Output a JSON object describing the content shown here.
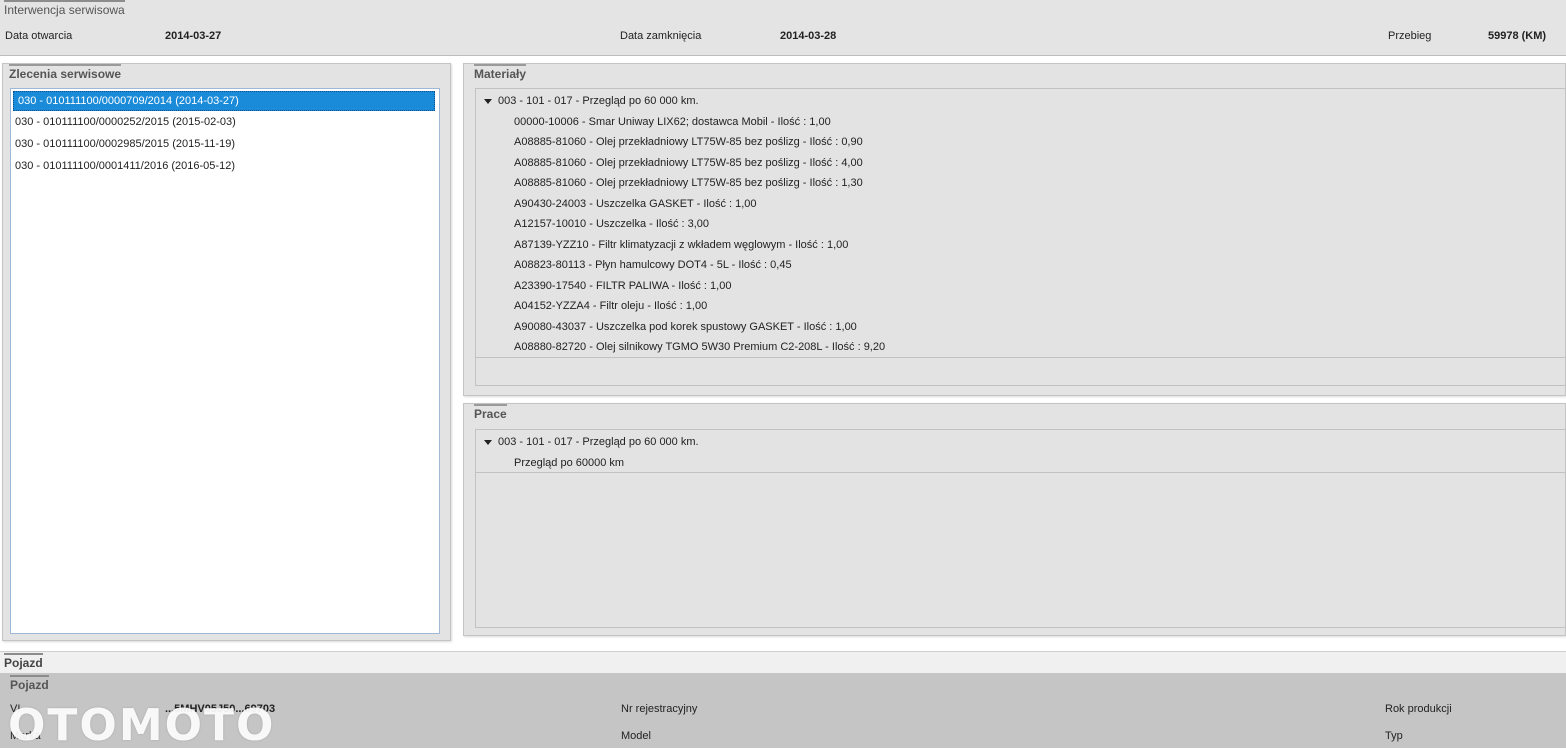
{
  "intervention": {
    "title": "Interwencja serwisowa",
    "open_label": "Data otwarcia",
    "open_value": "2014-03-27",
    "close_label": "Data zamknięcia",
    "close_value": "2014-03-28",
    "mileage_label": "Przebieg",
    "mileage_value": "59978 (KM)"
  },
  "orders": {
    "title": "Zlecenia serwisowe",
    "items": [
      "030 - 010111100/0000709/2014 (2014-03-27)",
      "030 - 010111100/0000252/2015 (2015-02-03)",
      "030 - 010111100/0002985/2015 (2015-11-19)",
      "030 - 010111100/0001411/2016 (2016-05-12)"
    ],
    "selected_index": 0
  },
  "materials": {
    "title": "Materiały",
    "root": "003 - 101 - 017 - Przegląd po 60 000 km.",
    "items": [
      "00000-10006 - Smar Uniway LIX62; dostawca Mobil - Ilość : 1,00",
      "A08885-81060 - Olej przekładniowy LT75W-85 bez poślizg - Ilość : 0,90",
      "A08885-81060 - Olej przekładniowy LT75W-85 bez poślizg - Ilość : 4,00",
      "A08885-81060 - Olej przekładniowy LT75W-85 bez poślizg - Ilość : 1,30",
      "A90430-24003 - Uszczelka GASKET - Ilość : 1,00",
      "A12157-10010 - Uszczelka - Ilość : 3,00",
      "A87139-YZZ10 - Filtr klimatyzacji z wkładem węglowym - Ilość : 1,00",
      "A08823-80113 - Płyn hamulcowy DOT4 - 5L - Ilość : 0,45",
      "A23390-17540 - FILTR PALIWA - Ilość : 1,00",
      "A04152-YZZA4 - Filtr oleju - Ilość : 1,00",
      "A90080-43037 - Uszczelka pod korek spustowy GASKET - Ilość : 1,00",
      "A08880-82720 - Olej silnikowy TGMO 5W30 Premium C2-208L - Ilość : 9,20"
    ]
  },
  "works": {
    "title": "Prace",
    "root": "003 - 101 - 017 - Przegląd po 60 000 km.",
    "items": [
      "Przegląd po 60000 km"
    ]
  },
  "vehicle": {
    "strip_title": "Pojazd",
    "panel_title": "Pojazd",
    "vin_label": "VI",
    "vin_value": "...5MHV05J50...69703",
    "brand_label": "Marka",
    "reg_label": "Nr rejestracyjny",
    "model_label": "Model",
    "year_label": "Rok produkcji",
    "type_label": "Typ"
  },
  "watermark": "OTOMOTO"
}
